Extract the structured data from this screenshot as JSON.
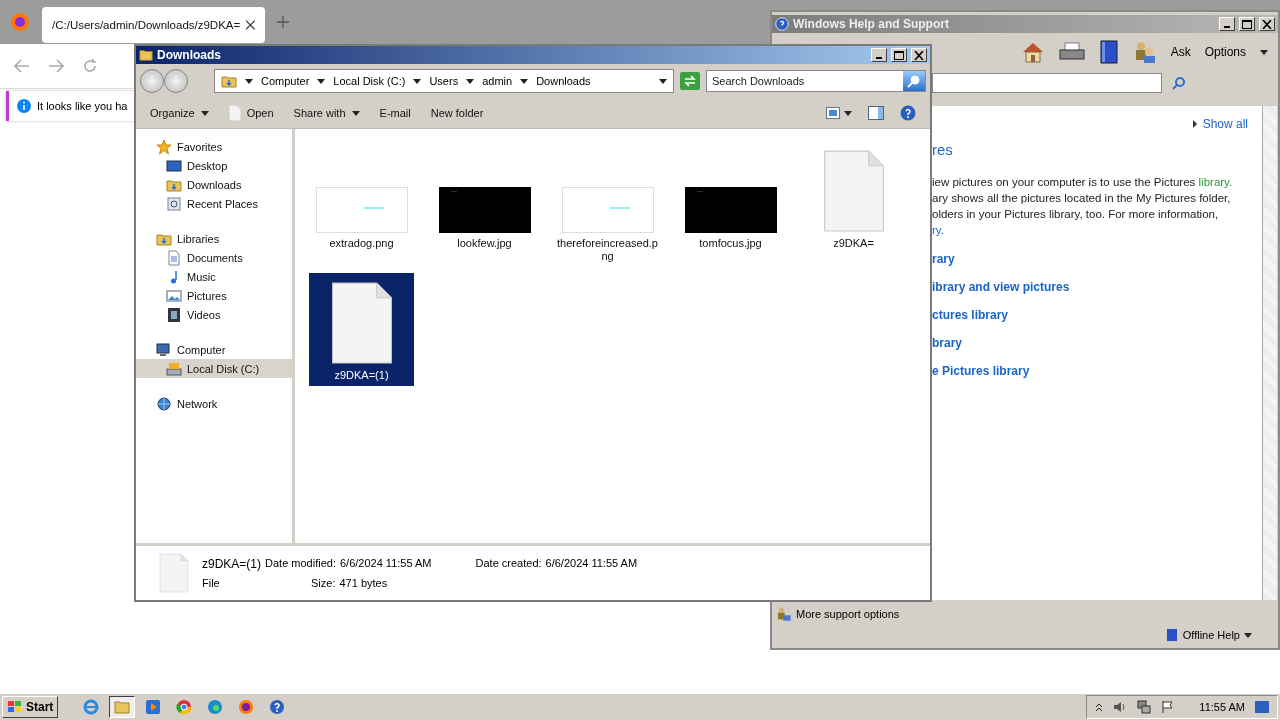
{
  "browser": {
    "tab": {
      "title": "/C:/Users/admin/Downloads/z9DKA=",
      "selected": true
    },
    "info_bar": "It looks like you ha"
  },
  "help_window": {
    "title": "Windows Help and Support",
    "toolbar": [
      "Ask",
      "Options"
    ],
    "show_all": "Show all",
    "heading": "res",
    "intro": [
      {
        "text": "iew pictures on your computer is to use the Pictures ",
        "link": "library."
      },
      {
        "text": "ary shows all the pictures located in the My Pictures folder,"
      },
      {
        "text": "olders in your Pictures library, too. For more information,"
      },
      {
        "link": "ry."
      }
    ],
    "links": [
      "rary",
      "ibrary and view pictures",
      "ctures library",
      "brary",
      "e Pictures library"
    ],
    "more_support": "More support options",
    "offline_help": "Offline Help"
  },
  "explorer": {
    "title": "Downloads",
    "breadcrumb": [
      "Computer",
      "Local Disk (C:)",
      "Users",
      "admin",
      "Downloads"
    ],
    "search": {
      "placeholder": "Search Downloads"
    },
    "toolbar": [
      {
        "label": "Organize",
        "kind": "menu"
      },
      {
        "label": "Open",
        "kind": "open"
      },
      {
        "label": "Share with",
        "kind": "menu"
      },
      {
        "label": "E-mail",
        "kind": "plain"
      },
      {
        "label": "New folder",
        "kind": "plain"
      }
    ],
    "nav": [
      {
        "label": "Favorites",
        "kind": "star",
        "selected": false,
        "children": [
          {
            "label": "Desktop",
            "kind": "desktop",
            "selected": false
          },
          {
            "label": "Downloads",
            "kind": "folder",
            "selected": false
          },
          {
            "label": "Recent Places",
            "kind": "recent",
            "selected": false
          }
        ]
      },
      {
        "label": "Libraries",
        "kind": "folder",
        "selected": false,
        "children": [
          {
            "label": "Documents",
            "kind": "doc",
            "selected": false
          },
          {
            "label": "Music",
            "kind": "music",
            "selected": false
          },
          {
            "label": "Pictures",
            "kind": "pictures",
            "selected": false
          },
          {
            "label": "Videos",
            "kind": "video",
            "selected": false
          }
        ]
      },
      {
        "label": "Computer",
        "kind": "computer",
        "selected": false,
        "children": [
          {
            "label": "Local Disk (C:)",
            "kind": "disk",
            "selected": true
          }
        ]
      },
      {
        "label": "Network",
        "kind": "network",
        "selected": false
      }
    ],
    "files": [
      {
        "name": "extradog.png",
        "kind": "light_image",
        "selected": false
      },
      {
        "name": "lookfew.jpg",
        "kind": "dark_image",
        "selected": false
      },
      {
        "name": "thereforeincreased.png",
        "kind": "light_image",
        "selected": false
      },
      {
        "name": "tomfocus.jpg",
        "kind": "dark_image",
        "selected": false
      },
      {
        "name": "z9DKA=",
        "kind": "blank",
        "selected": false
      },
      {
        "name": "z9DKA=(1)",
        "kind": "blank",
        "selected": true
      }
    ],
    "details": {
      "name": "z9DKA=(1)",
      "type": "File",
      "fields": [
        {
          "label": "Date modified:",
          "value": "6/6/2024 11:55 AM"
        },
        {
          "label": "Size:",
          "value": "471 bytes"
        },
        {
          "label": "Date created:",
          "value": "6/6/2024 11:55 AM"
        }
      ]
    }
  },
  "taskbar": {
    "start": "Start",
    "apps": [
      {
        "kind": "ie",
        "selected": false
      },
      {
        "kind": "explorer",
        "selected": true
      },
      {
        "kind": "media",
        "selected": false
      },
      {
        "kind": "chrome",
        "selected": false
      },
      {
        "kind": "edge",
        "selected": false
      },
      {
        "kind": "firefox",
        "selected": false
      },
      {
        "kind": "help",
        "selected": false
      }
    ],
    "clock": "11:55 AM"
  }
}
